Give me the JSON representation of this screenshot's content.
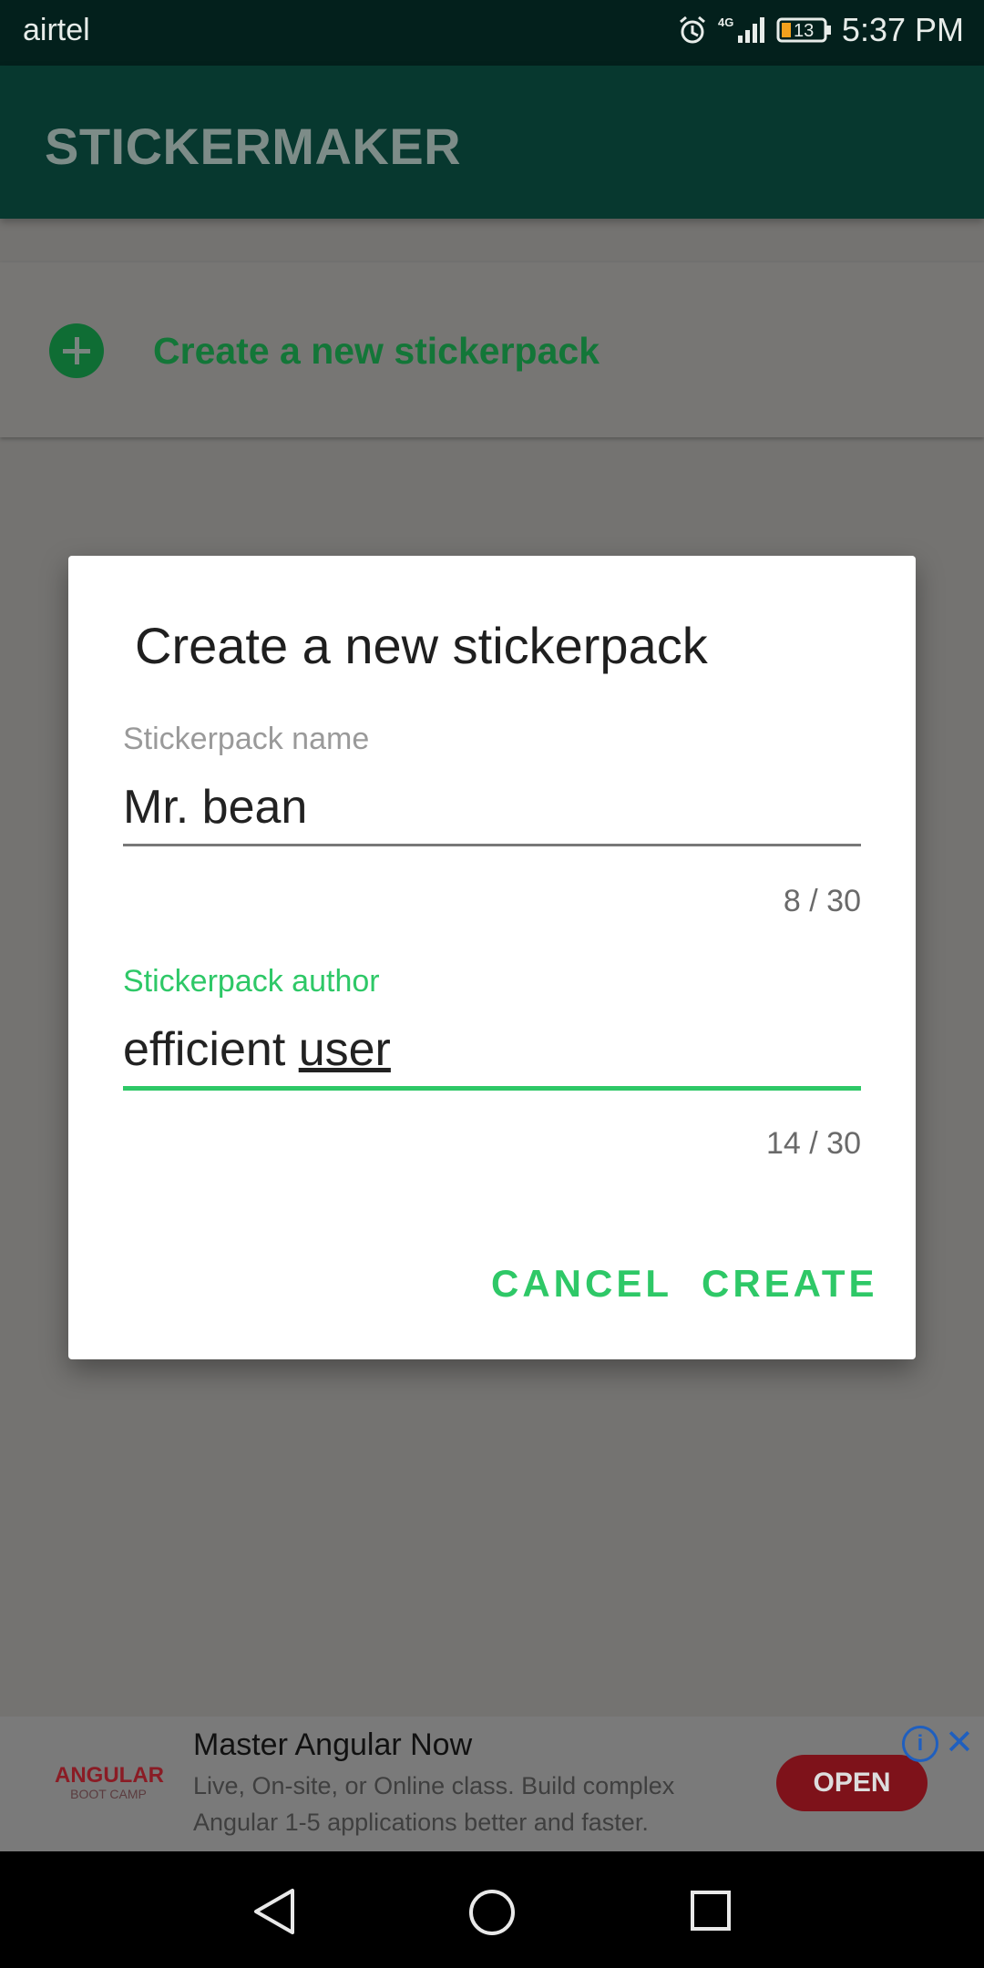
{
  "status_bar": {
    "carrier": "airtel",
    "time": "5:37 PM",
    "battery": "13",
    "network": "4G"
  },
  "app_bar": {
    "title": "STICKERMAKER"
  },
  "create_card": {
    "label": "Create a new stickerpack"
  },
  "dialog": {
    "title": "Create a new stickerpack",
    "name_field": {
      "label": "Stickerpack name",
      "value": "Mr. bean",
      "counter": "8 / 30"
    },
    "author_field": {
      "label": "Stickerpack author",
      "value_prefix": "efficient ",
      "value_suffix": "user",
      "counter": "14 / 30"
    },
    "cancel_label": "CANCEL",
    "create_label": "CREATE"
  },
  "ad": {
    "logo_top": "ANGULAR",
    "logo_bottom": "BOOT CAMP",
    "title": "Master Angular Now",
    "body": "Live, On-site, or Online class. Build complex Angular 1-5 applications better and faster.",
    "open_label": "OPEN",
    "info_label": "i",
    "close_label": "✕"
  },
  "colors": {
    "accent": "#2ec867",
    "dialog_bg": "#ffffff",
    "app_bar": "#07382f",
    "status_bar": "#03201c"
  }
}
